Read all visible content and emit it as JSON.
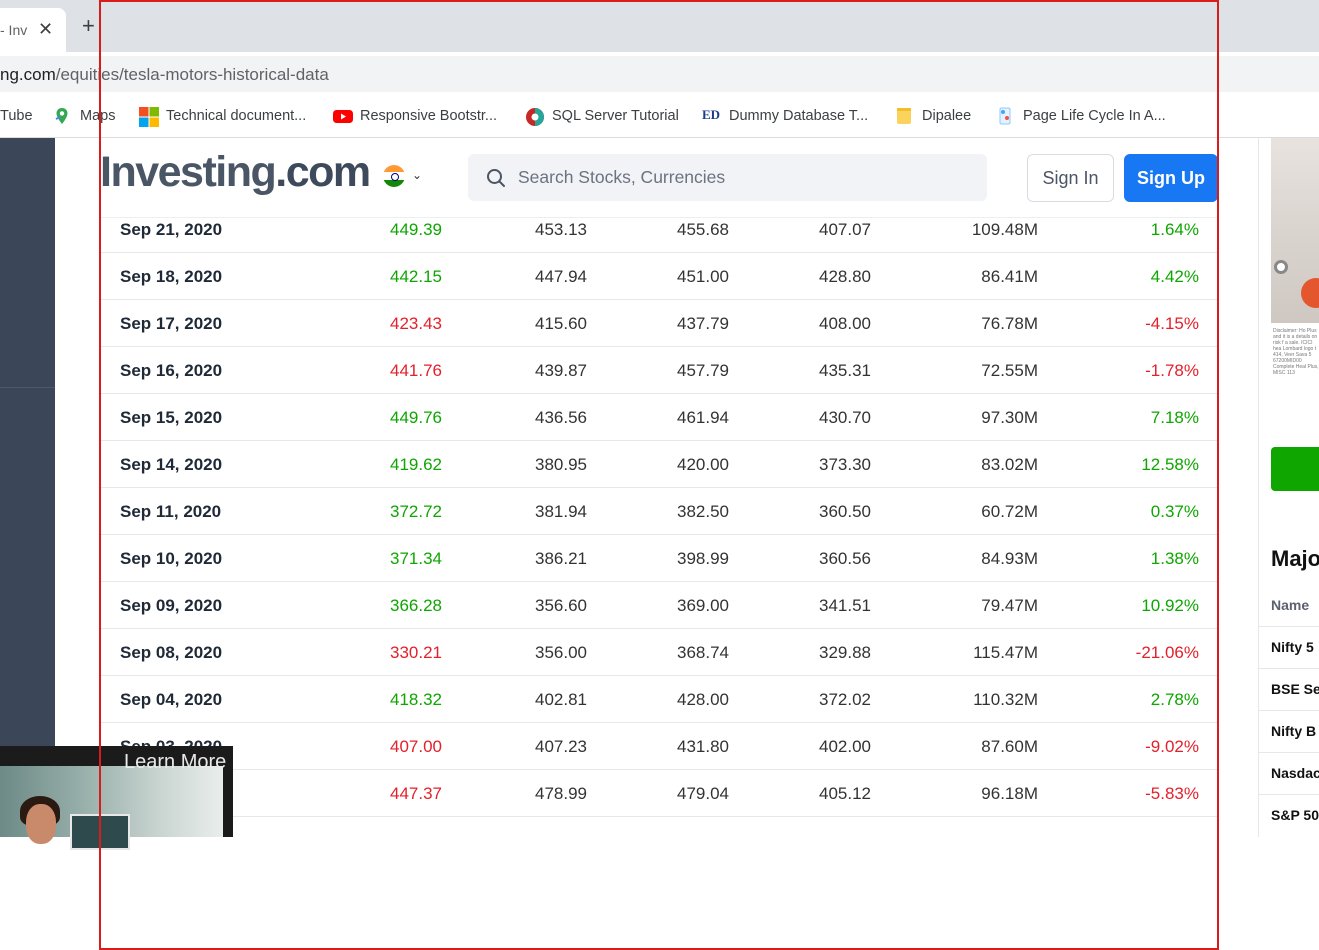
{
  "browser": {
    "tab_title": "- Inv",
    "url_domain": "ng.com",
    "url_path": "/equities/tesla-motors-historical-data",
    "bookmarks": [
      {
        "label": "Tube",
        "icon": "youtube-icon"
      },
      {
        "label": "Maps",
        "icon": "maps-icon"
      },
      {
        "label": "Technical document...",
        "icon": "microsoft-icon"
      },
      {
        "label": "Responsive Bootstr...",
        "icon": "youtube-icon"
      },
      {
        "label": "SQL Server Tutorial",
        "icon": "sql-icon"
      },
      {
        "label": "Dummy Database T...",
        "icon": "ed-icon"
      },
      {
        "label": "Dipalee",
        "icon": "folder-icon"
      },
      {
        "label": "Page Life Cycle In A...",
        "icon": "page-icon"
      }
    ]
  },
  "header": {
    "logo_main": "Investing",
    "logo_suffix": ".com",
    "search_placeholder": "Search Stocks, Currencies",
    "sign_in": "Sign In",
    "sign_up": "Sign Up"
  },
  "table": {
    "rows": [
      {
        "date": "Sep 21, 2020",
        "price": "449.39",
        "open": "453.13",
        "high": "455.68",
        "low": "407.07",
        "vol": "109.48M",
        "change": "1.64%",
        "dir": "up"
      },
      {
        "date": "Sep 18, 2020",
        "price": "442.15",
        "open": "447.94",
        "high": "451.00",
        "low": "428.80",
        "vol": "86.41M",
        "change": "4.42%",
        "dir": "up"
      },
      {
        "date": "Sep 17, 2020",
        "price": "423.43",
        "open": "415.60",
        "high": "437.79",
        "low": "408.00",
        "vol": "76.78M",
        "change": "-4.15%",
        "dir": "down"
      },
      {
        "date": "Sep 16, 2020",
        "price": "441.76",
        "open": "439.87",
        "high": "457.79",
        "low": "435.31",
        "vol": "72.55M",
        "change": "-1.78%",
        "dir": "down"
      },
      {
        "date": "Sep 15, 2020",
        "price": "449.76",
        "open": "436.56",
        "high": "461.94",
        "low": "430.70",
        "vol": "97.30M",
        "change": "7.18%",
        "dir": "up"
      },
      {
        "date": "Sep 14, 2020",
        "price": "419.62",
        "open": "380.95",
        "high": "420.00",
        "low": "373.30",
        "vol": "83.02M",
        "change": "12.58%",
        "dir": "up"
      },
      {
        "date": "Sep 11, 2020",
        "price": "372.72",
        "open": "381.94",
        "high": "382.50",
        "low": "360.50",
        "vol": "60.72M",
        "change": "0.37%",
        "dir": "up"
      },
      {
        "date": "Sep 10, 2020",
        "price": "371.34",
        "open": "386.21",
        "high": "398.99",
        "low": "360.56",
        "vol": "84.93M",
        "change": "1.38%",
        "dir": "up"
      },
      {
        "date": "Sep 09, 2020",
        "price": "366.28",
        "open": "356.60",
        "high": "369.00",
        "low": "341.51",
        "vol": "79.47M",
        "change": "10.92%",
        "dir": "up"
      },
      {
        "date": "Sep 08, 2020",
        "price": "330.21",
        "open": "356.00",
        "high": "368.74",
        "low": "329.88",
        "vol": "115.47M",
        "change": "-21.06%",
        "dir": "down"
      },
      {
        "date": "Sep 04, 2020",
        "price": "418.32",
        "open": "402.81",
        "high": "428.00",
        "low": "372.02",
        "vol": "110.32M",
        "change": "2.78%",
        "dir": "up"
      },
      {
        "date": "Sep 03, 2020",
        "price": "407.00",
        "open": "407.23",
        "high": "431.80",
        "low": "402.00",
        "vol": "87.60M",
        "change": "-9.02%",
        "dir": "down"
      },
      {
        "date": "",
        "price": "447.37",
        "open": "478.99",
        "high": "479.04",
        "low": "405.12",
        "vol": "96.18M",
        "change": "-5.83%",
        "dir": "down"
      }
    ]
  },
  "sidebar_right": {
    "ad_disclaimer": "Disclaimer: Ho Plus and it is a details on risk f a sale. ICICI hea Lombard logo t 414, Veer Sava 5 67200MID00 Complete Heal Plus, MISC 113",
    "major_heading": "Majo",
    "column_name": "Name",
    "indices": [
      "Nifty 5",
      "BSE Ser",
      "Nifty B",
      "Nasdac",
      "S&P 50"
    ]
  },
  "video_ad": {
    "learn_more": "Learn More"
  },
  "colors": {
    "up": "#0ea600",
    "down": "#e4202a",
    "signup_bg": "#1877f2",
    "nav_bg": "#3c4659",
    "highlight_box": "#d81c1c"
  }
}
